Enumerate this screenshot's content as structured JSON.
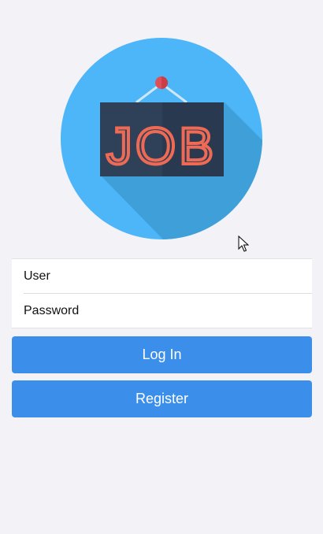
{
  "logo": {
    "icon": "job-sign-icon",
    "text": "JOB",
    "colors": {
      "circle": "#4db6f9",
      "shadow": "#3f9fd9",
      "board": "#2f4159",
      "board_dark": "#293a50",
      "letters": "#ee6a55",
      "pin": "#e04f57"
    }
  },
  "form": {
    "user_placeholder": "User",
    "password_placeholder": "Password"
  },
  "buttons": {
    "login_label": "Log In",
    "register_label": "Register"
  },
  "theme": {
    "background": "#f2f2f7",
    "accent": "#3b8fea"
  }
}
